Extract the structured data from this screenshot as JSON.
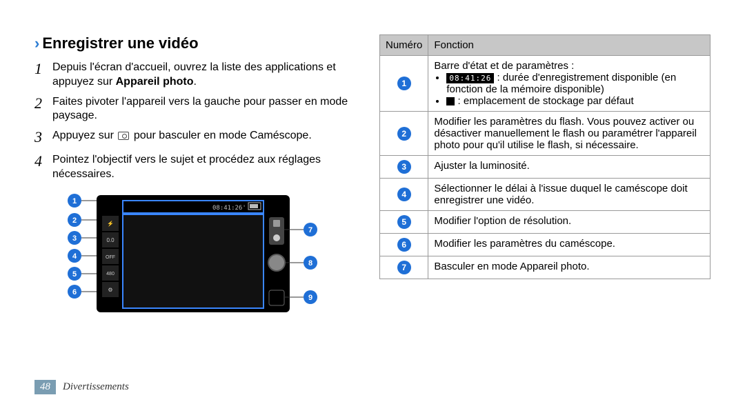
{
  "section_title": "Enregistrer une vidéo",
  "steps": [
    "Depuis l'écran d'accueil, ouvrez la liste des applications et appuyez sur **Appareil photo**.",
    "Faites pivoter l'appareil vers la gauche pour passer en mode paysage.",
    "Appuyez sur [CAM] pour basculer en mode Caméscope.",
    "Pointez l'objectif vers le sujet et procédez aux réglages nécessaires."
  ],
  "diagram": {
    "status_time": "08:41:26",
    "left_icons": [
      "flash-off",
      "0.0",
      "timer-off",
      "res-480",
      "settings"
    ],
    "right_icons": [
      "mode-switch",
      "record",
      "gallery"
    ]
  },
  "table": {
    "headers": [
      "Numéro",
      "Fonction"
    ],
    "rows": [
      {
        "n": "1",
        "body_intro": "Barre d'état et de paramètres :",
        "bullets": [
          {
            "prefix_lcd": "08:41:26",
            "text": " : durée d'enregistrement disponible (en fonction de la mémoire disponible)"
          },
          {
            "prefix_sq": true,
            "text": " : emplacement de stockage par défaut"
          }
        ]
      },
      {
        "n": "2",
        "text": "Modifier les paramètres du flash. Vous pouvez activer ou désactiver manuellement le flash ou paramétrer l'appareil photo pour qu'il utilise le flash, si nécessaire."
      },
      {
        "n": "3",
        "text": "Ajuster la luminosité."
      },
      {
        "n": "4",
        "text": "Sélectionner le délai à l'issue duquel le caméscope doit enregistrer une vidéo."
      },
      {
        "n": "5",
        "text": "Modifier l'option de résolution."
      },
      {
        "n": "6",
        "text": "Modifier les paramètres du caméscope."
      },
      {
        "n": "7",
        "text": "Basculer en mode Appareil photo."
      }
    ]
  },
  "footer": {
    "page": "48",
    "chapter": "Divertissements"
  }
}
